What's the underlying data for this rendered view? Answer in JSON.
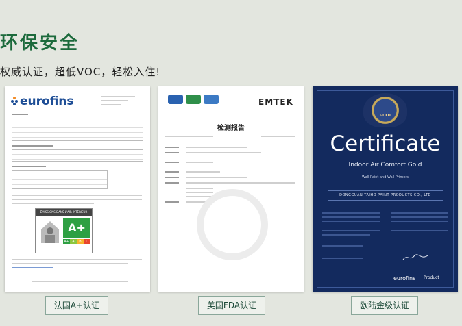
{
  "header": {
    "title": "环保安全",
    "subtitle": "权威认证，超低VOC，轻松入住!"
  },
  "cards": [
    {
      "logo_text": "eurofins",
      "label_heading": "ÉMISSIONS DANS L'AIR INTÉRIEUR",
      "rating": "A+",
      "scale": [
        "A+",
        "A",
        "B",
        "C"
      ],
      "caption": "法国A+认证"
    },
    {
      "logo_text": "EMTEK",
      "report_title": "检测报告",
      "caption": "美国FDA认证"
    },
    {
      "heading": "Certificate",
      "subheading": "Indoor Air Comfort Gold",
      "product_line": "Wall Paint and Wall Primers",
      "company": "DONGGUAN TAIHO PAINT PRODUCTS CO., LTD",
      "footer_logo": "eurofins",
      "footer_product": "Product",
      "caption": "欧陆金级认证"
    }
  ],
  "colors": {
    "title_green": "#1c6a3c",
    "cert_blue": "#132a5e",
    "aplus_green": "#2ea043"
  }
}
